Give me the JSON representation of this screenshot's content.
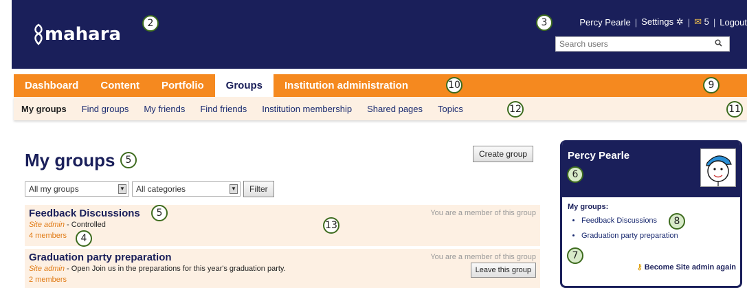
{
  "header": {
    "logo_text": "mahara",
    "user_name": "Percy Pearle",
    "settings_label": "Settings",
    "inbox_count": "5",
    "logout_label": "Logout",
    "search_placeholder": "Search users",
    "separator": "|"
  },
  "nav": {
    "items": [
      {
        "label": "Dashboard"
      },
      {
        "label": "Content"
      },
      {
        "label": "Portfolio"
      },
      {
        "label": "Groups"
      },
      {
        "label": "Institution administration"
      }
    ]
  },
  "subnav": {
    "items": [
      {
        "label": "My groups"
      },
      {
        "label": "Find groups"
      },
      {
        "label": "My friends"
      },
      {
        "label": "Find friends"
      },
      {
        "label": "Institution membership"
      },
      {
        "label": "Shared pages"
      },
      {
        "label": "Topics"
      }
    ]
  },
  "main": {
    "title": "My groups",
    "create_button": "Create group",
    "filter1": "All my groups",
    "filter2": "All categories",
    "filter_button": "Filter",
    "groups": [
      {
        "title": "Feedback Discussions",
        "role": "Site admin",
        "description": " - Controlled",
        "members": "4 members",
        "status": "You are a member of this group"
      },
      {
        "title": "Graduation party preparation",
        "role": "Site admin",
        "description": " - Open Join us in the preparations for this year's graduation party.",
        "members": "2 members",
        "status": "You are a member of this group",
        "leave_button": "Leave this group"
      }
    ]
  },
  "sidebar": {
    "name": "Percy Pearle",
    "groups_title": "My groups:",
    "groups": [
      "Feedback Discussions",
      "Graduation party preparation"
    ],
    "become_label": "Become Site admin again"
  },
  "callouts": [
    "2",
    "3",
    "5",
    "5",
    "4",
    "13",
    "10",
    "9",
    "12",
    "11",
    "6",
    "8",
    "7"
  ]
}
